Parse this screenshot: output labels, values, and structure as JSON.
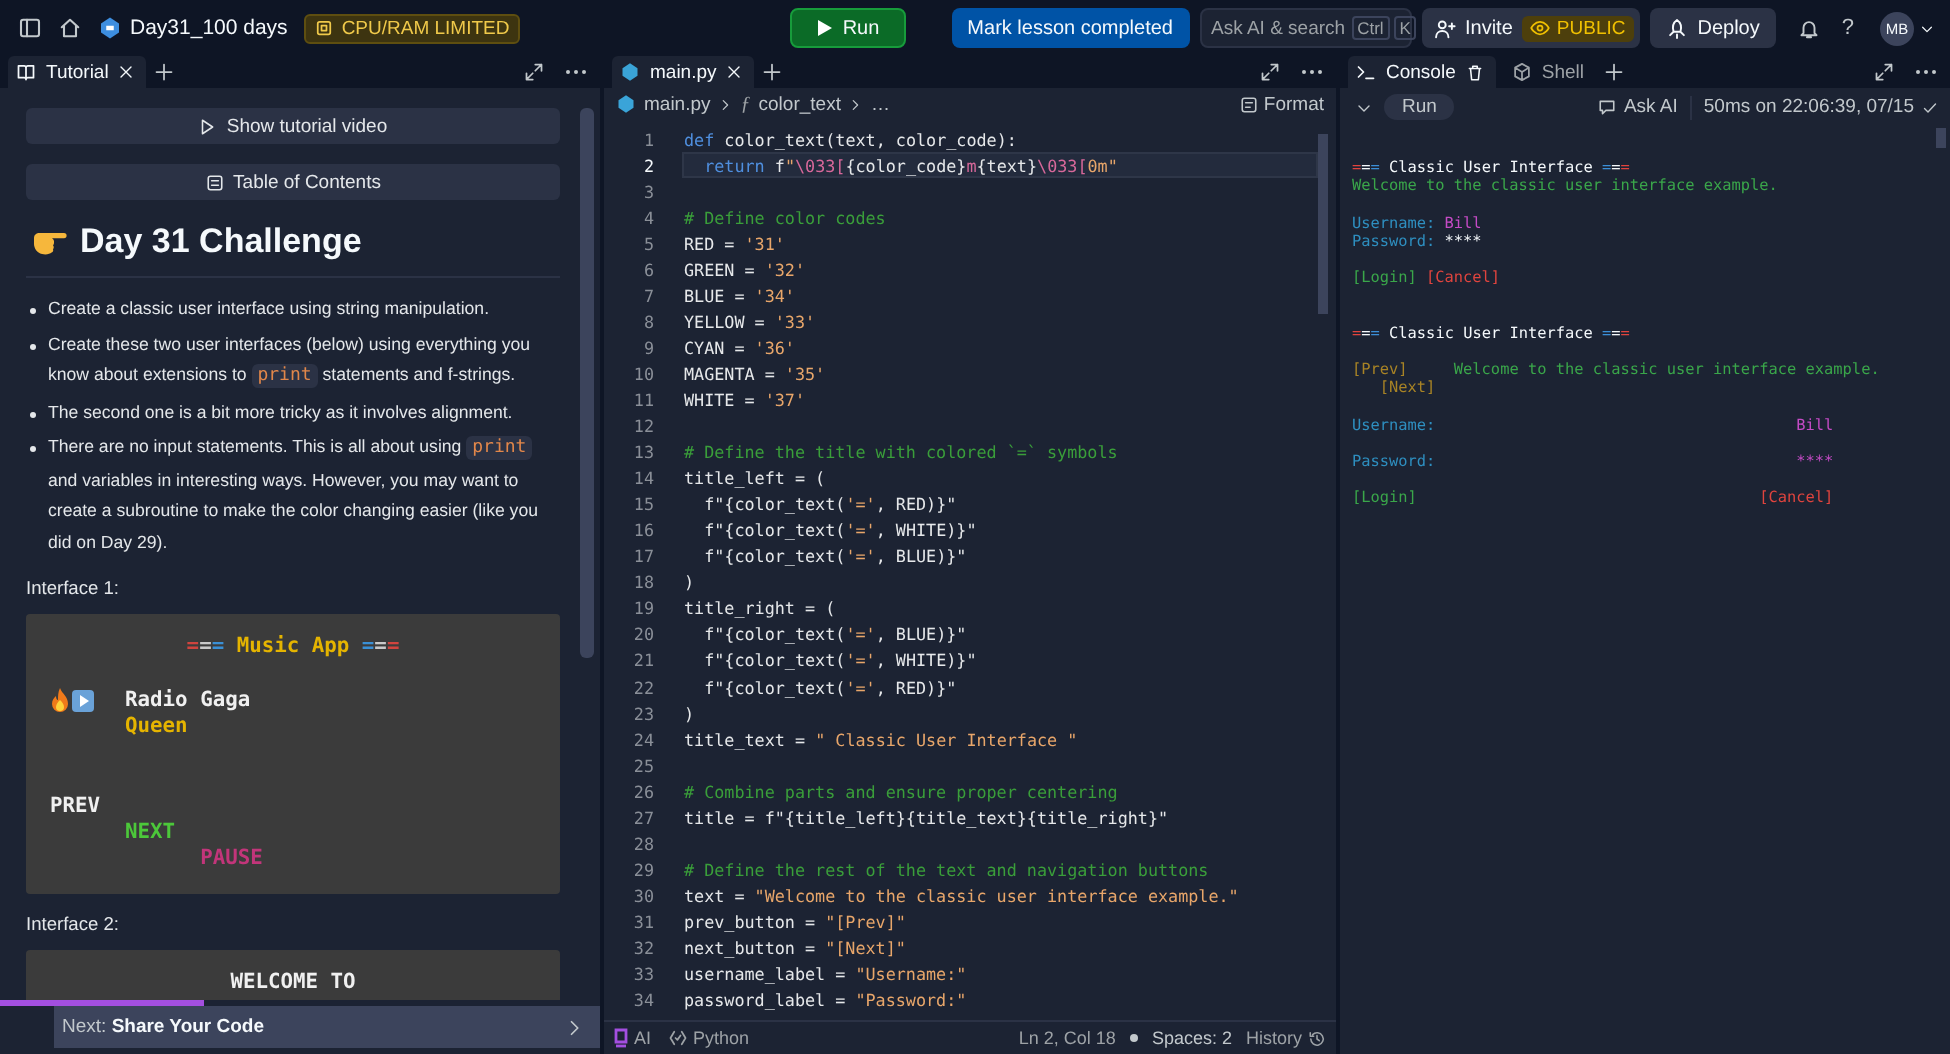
{
  "topbar": {
    "project": "Day31_100 days",
    "resource_badge": "CPU/RAM LIMITED",
    "run": "Run",
    "mark_complete": "Mark lesson completed",
    "search": {
      "placeholder": "Ask AI & search",
      "keys": [
        "Ctrl",
        "K"
      ]
    },
    "invite": "Invite",
    "visibility": "PUBLIC",
    "deploy": "Deploy",
    "help": "?",
    "avatar": "MB"
  },
  "tutorial": {
    "tabs": [
      {
        "kind": "tutorial",
        "label": "Tutorial",
        "selected": true
      }
    ],
    "video_button": "Show tutorial video",
    "toc_button": "Table of Contents",
    "heading": "Day 31 Challenge",
    "bullets": [
      {
        "segments": [
          {
            "kind": "text",
            "text": "Create a classic user interface using string manipulation."
          }
        ]
      },
      {
        "segments": [
          {
            "kind": "text",
            "text": "Create these two user interfaces (below) using everything you know about extensions to "
          },
          {
            "kind": "code",
            "text": "print"
          },
          {
            "kind": "text",
            "text": " statements and f-strings."
          }
        ]
      },
      {
        "segments": [
          {
            "kind": "text",
            "text": "The second one is a bit more tricky as it involves alignment."
          }
        ]
      },
      {
        "segments": [
          {
            "kind": "text",
            "text": "There are no input statements. This is all about using "
          },
          {
            "kind": "code",
            "text": "print"
          },
          {
            "kind": "text",
            "text": " and variables in interesting ways. However, you may want to create a subroutine to make the color changing easier (like you did on Day 29)."
          }
        ]
      }
    ],
    "interfaces": [
      {
        "label": "Interface 1:",
        "lines": [
          {
            "kind": "center",
            "segments": [
              {
                "kind": "rule",
                "text": "=",
                "color": "#d0443e"
              },
              {
                "kind": "rule",
                "text": "=",
                "color": "#c9c9c9"
              },
              {
                "kind": "rule",
                "text": "=",
                "color": "#3a90d6"
              },
              {
                "kind": "text",
                "text": "Music App",
                "color": "#e5b400"
              },
              {
                "kind": "rule",
                "text": "=",
                "color": "#3a90d6"
              },
              {
                "kind": "rule",
                "text": "=",
                "color": "#c9c9c9"
              },
              {
                "kind": "rule",
                "text": "=",
                "color": "#d0443e"
              }
            ]
          },
          {
            "kind": "blank"
          },
          {
            "kind": "player",
            "segments": [
              {
                "kind": "text",
                "text": "Radio Gaga",
                "color": "#f0f0f0"
              }
            ]
          },
          {
            "kind": "indented",
            "segments": [
              {
                "kind": "text",
                "text": "Queen",
                "color": "#e5b400"
              }
            ]
          },
          {
            "kind": "blank"
          },
          {
            "kind": "blank"
          },
          {
            "kind": "left",
            "segments": [
              {
                "kind": "text",
                "text": "PREV",
                "color": "#f0f0f0"
              }
            ]
          },
          {
            "kind": "indented",
            "segments": [
              {
                "kind": "text",
                "text": "NEXT",
                "color": "#4cc83a"
              }
            ]
          },
          {
            "kind": "further",
            "segments": [
              {
                "kind": "text",
                "text": "PAUSE",
                "color": "#c2357a"
              }
            ]
          }
        ]
      },
      {
        "label": "Interface 2:",
        "lines": [
          {
            "kind": "center",
            "segments": [
              {
                "kind": "text",
                "text": "WELCOME TO",
                "color": "#f0f0f0"
              }
            ]
          }
        ]
      }
    ],
    "next": {
      "text": "Next: **Share Your Code**",
      "level": 0.34
    }
  },
  "editor": {
    "tabs": [
      {
        "kind": "file",
        "label": "main.py",
        "selected": true
      }
    ],
    "breadcrumb": [
      "main.py",
      "color_text",
      "…"
    ],
    "symbol_icon": "ƒ",
    "format": "Format",
    "lines": [
      {
        "number": "1",
        "current": false,
        "tokens": [
          {
            "kind": "keyword",
            "text": "def"
          },
          {
            "kind": "plain",
            "text": " color_text(text, color_code):"
          }
        ]
      },
      {
        "number": "2",
        "current": true,
        "tokens": [
          {
            "kind": "keyword",
            "text": "  return"
          },
          {
            "kind": "plain",
            "text": " f"
          },
          {
            "kind": "string",
            "text": "\""
          },
          {
            "kind": "escape",
            "text": "\\033["
          },
          {
            "kind": "plain",
            "text": "{color_code}"
          },
          {
            "kind": "escape",
            "text": "m"
          },
          {
            "kind": "plain",
            "text": "{text}"
          },
          {
            "kind": "escape",
            "text": "\\033["
          },
          {
            "kind": "string",
            "text": "0m\""
          }
        ]
      },
      {
        "number": "3",
        "current": false
      },
      {
        "number": "4",
        "current": false,
        "tokens": [
          {
            "kind": "comment",
            "text": "# Define color codes"
          }
        ]
      },
      {
        "number": "5",
        "current": false,
        "tokens": [
          {
            "kind": "plain",
            "text": "RED = "
          },
          {
            "kind": "string",
            "text": "'31'"
          }
        ]
      },
      {
        "number": "6",
        "current": false,
        "tokens": [
          {
            "kind": "plain",
            "text": "GREEN = "
          },
          {
            "kind": "string",
            "text": "'32'"
          }
        ]
      },
      {
        "number": "7",
        "current": false,
        "tokens": [
          {
            "kind": "plain",
            "text": "BLUE = "
          },
          {
            "kind": "string",
            "text": "'34'"
          }
        ]
      },
      {
        "number": "8",
        "current": false,
        "tokens": [
          {
            "kind": "plain",
            "text": "YELLOW = "
          },
          {
            "kind": "string",
            "text": "'33'"
          }
        ]
      },
      {
        "number": "9",
        "current": false,
        "tokens": [
          {
            "kind": "plain",
            "text": "CYAN = "
          },
          {
            "kind": "string",
            "text": "'36'"
          }
        ]
      },
      {
        "number": "10",
        "current": false,
        "tokens": [
          {
            "kind": "plain",
            "text": "MAGENTA = "
          },
          {
            "kind": "string",
            "text": "'35'"
          }
        ]
      },
      {
        "number": "11",
        "current": false,
        "tokens": [
          {
            "kind": "plain",
            "text": "WHITE = "
          },
          {
            "kind": "string",
            "text": "'37'"
          }
        ]
      },
      {
        "number": "12",
        "current": false
      },
      {
        "number": "13",
        "current": false,
        "tokens": [
          {
            "kind": "comment",
            "text": "# Define the title with colored `=` symbols"
          }
        ]
      },
      {
        "number": "14",
        "current": false,
        "tokens": [
          {
            "kind": "plain",
            "text": "title_left = ("
          }
        ]
      },
      {
        "number": "15",
        "current": false,
        "tokens": [
          {
            "kind": "plain",
            "text": "  f\"{color_text("
          },
          {
            "kind": "string",
            "text": "'='"
          },
          {
            "kind": "plain",
            "text": ", RED)}\""
          }
        ]
      },
      {
        "number": "16",
        "current": false,
        "tokens": [
          {
            "kind": "plain",
            "text": "  f\"{color_text("
          },
          {
            "kind": "string",
            "text": "'='"
          },
          {
            "kind": "plain",
            "text": ", WHITE)}\""
          }
        ]
      },
      {
        "number": "17",
        "current": false,
        "tokens": [
          {
            "kind": "plain",
            "text": "  f\"{color_text("
          },
          {
            "kind": "string",
            "text": "'='"
          },
          {
            "kind": "plain",
            "text": ", BLUE)}\""
          }
        ]
      },
      {
        "number": "18",
        "current": false,
        "tokens": [
          {
            "kind": "plain",
            "text": ")"
          }
        ]
      },
      {
        "number": "19",
        "current": false,
        "tokens": [
          {
            "kind": "plain",
            "text": "title_right = ("
          }
        ]
      },
      {
        "number": "20",
        "current": false,
        "tokens": [
          {
            "kind": "plain",
            "text": "  f\"{color_text("
          },
          {
            "kind": "string",
            "text": "'='"
          },
          {
            "kind": "plain",
            "text": ", BLUE)}\""
          }
        ]
      },
      {
        "number": "21",
        "current": false,
        "tokens": [
          {
            "kind": "plain",
            "text": "  f\"{color_text("
          },
          {
            "kind": "string",
            "text": "'='"
          },
          {
            "kind": "plain",
            "text": ", WHITE)}\""
          }
        ]
      },
      {
        "number": "22",
        "current": false,
        "tokens": [
          {
            "kind": "plain",
            "text": "  f\"{color_text("
          },
          {
            "kind": "string",
            "text": "'='"
          },
          {
            "kind": "plain",
            "text": ", RED)}\""
          }
        ]
      },
      {
        "number": "23",
        "current": false,
        "tokens": [
          {
            "kind": "plain",
            "text": ")"
          }
        ]
      },
      {
        "number": "24",
        "current": false,
        "tokens": [
          {
            "kind": "plain",
            "text": "title_text = "
          },
          {
            "kind": "string",
            "text": "\" Classic User Interface \""
          }
        ]
      },
      {
        "number": "25",
        "current": false
      },
      {
        "number": "26",
        "current": false,
        "tokens": [
          {
            "kind": "comment",
            "text": "# Combine parts and ensure proper centering"
          }
        ]
      },
      {
        "number": "27",
        "current": false,
        "tokens": [
          {
            "kind": "plain",
            "text": "title = f\"{title_left}{title_text}{title_right}\""
          }
        ]
      },
      {
        "number": "28",
        "current": false
      },
      {
        "number": "29",
        "current": false,
        "tokens": [
          {
            "kind": "comment",
            "text": "# Define the rest of the text and navigation buttons"
          }
        ]
      },
      {
        "number": "30",
        "current": false,
        "tokens": [
          {
            "kind": "plain",
            "text": "text = "
          },
          {
            "kind": "string",
            "text": "\"Welcome to the classic user interface example.\""
          }
        ]
      },
      {
        "number": "31",
        "current": false,
        "tokens": [
          {
            "kind": "plain",
            "text": "prev_button = "
          },
          {
            "kind": "string",
            "text": "\"[Prev]\""
          }
        ]
      },
      {
        "number": "32",
        "current": false,
        "tokens": [
          {
            "kind": "plain",
            "text": "next_button = "
          },
          {
            "kind": "string",
            "text": "\"[Next]\""
          }
        ]
      },
      {
        "number": "33",
        "current": false,
        "tokens": [
          {
            "kind": "plain",
            "text": "username_label = "
          },
          {
            "kind": "string",
            "text": "\"Username:\""
          }
        ]
      },
      {
        "number": "34",
        "current": false,
        "tokens": [
          {
            "kind": "plain",
            "text": "password_label = "
          },
          {
            "kind": "string",
            "text": "\"Password:\""
          }
        ]
      }
    ],
    "status_bar": {
      "ai": "AI",
      "language": "Python",
      "position": "Ln 2, Col 18",
      "spaces": "Spaces: 2",
      "history": "History"
    }
  },
  "console": {
    "tabs": [
      {
        "kind": "console",
        "label": "Console",
        "selected": true
      },
      {
        "kind": "shell",
        "label": "Shell",
        "selected": false
      }
    ],
    "run": "Run",
    "ask_ai": "Ask AI",
    "timing": "50ms on 22:06:39, 07/15",
    "lines": [
      {
        "kind": "left",
        "segments": [
          {
            "kind": "rule",
            "text": "=",
            "color": "#e0443e"
          },
          {
            "kind": "rule",
            "text": "=",
            "color": "#f5f9fc"
          },
          {
            "kind": "rule",
            "text": "=",
            "color": "#3b8fd8"
          },
          {
            "kind": "text",
            "text": "Classic User Interface",
            "color": "#f5f9fc"
          },
          {
            "kind": "rule",
            "text": "=",
            "color": "#3b8fd8"
          },
          {
            "kind": "rule",
            "text": "=",
            "color": "#f5f9fc"
          },
          {
            "kind": "rule",
            "text": "=",
            "color": "#e0443e"
          }
        ]
      },
      {
        "kind": "left",
        "segments": [
          {
            "kind": "text",
            "text": "Welcome to the classic user interface example.",
            "color": "#3aa64a"
          }
        ]
      },
      {
        "kind": "blank"
      },
      {
        "kind": "left",
        "segments": [
          {
            "kind": "text",
            "text": "Username:",
            "color": "#2e8fc0"
          },
          {
            "kind": "text",
            "text": "Bill",
            "color": "#c54bc6"
          }
        ]
      },
      {
        "kind": "left",
        "segments": [
          {
            "kind": "text",
            "text": "Password:",
            "color": "#2e8fc0"
          },
          {
            "kind": "text",
            "text": "****",
            "color": "#f5f9fc"
          }
        ]
      },
      {
        "kind": "blank"
      },
      {
        "kind": "left",
        "segments": [
          {
            "kind": "text",
            "text": "[Login]",
            "color": "#3aa64a"
          },
          {
            "kind": "text",
            "text": "[Cancel]",
            "color": "#e0443e"
          }
        ]
      },
      {
        "kind": "blank"
      },
      {
        "kind": "blank"
      },
      {
        "kind": "left",
        "segments": [
          {
            "kind": "rule",
            "text": "=",
            "color": "#e0443e"
          },
          {
            "kind": "rule",
            "text": "=",
            "color": "#f5f9fc"
          },
          {
            "kind": "rule",
            "text": "=",
            "color": "#3b8fd8"
          },
          {
            "kind": "text",
            "text": "Classic User Interface",
            "color": "#f5f9fc"
          },
          {
            "kind": "rule",
            "text": "=",
            "color": "#3b8fd8"
          },
          {
            "kind": "rule",
            "text": "=",
            "color": "#f5f9fc"
          },
          {
            "kind": "rule",
            "text": "=",
            "color": "#e0443e"
          }
        ]
      },
      {
        "kind": "blank"
      },
      {
        "kind": "wide",
        "segments": [
          {
            "kind": "text",
            "text": "[Prev]",
            "color": "#a88325"
          },
          {
            "kind": "text",
            "text": "Welcome to the classic user interface example.",
            "color": "#3aa64a"
          }
        ]
      },
      {
        "kind": "indented",
        "segments": [
          {
            "kind": "text",
            "text": "[Next]",
            "color": "#a88325"
          }
        ]
      },
      {
        "kind": "blank"
      },
      {
        "kind": "split",
        "segments": [
          {
            "kind": "text",
            "text": "Username:",
            "color": "#2e8fc0"
          },
          {
            "kind": "text",
            "text": "Bill",
            "color": "#c54bc6"
          }
        ]
      },
      {
        "kind": "blank"
      },
      {
        "kind": "split",
        "segments": [
          {
            "kind": "text",
            "text": "Password:",
            "color": "#2e8fc0"
          },
          {
            "kind": "text",
            "text": "****",
            "color": "#c54bc6"
          }
        ]
      },
      {
        "kind": "blank"
      },
      {
        "kind": "split",
        "segments": [
          {
            "kind": "text",
            "text": "[Login]",
            "color": "#3aa64a"
          },
          {
            "kind": "text",
            "text": "[Cancel]",
            "color": "#e0443e"
          }
        ]
      }
    ]
  }
}
